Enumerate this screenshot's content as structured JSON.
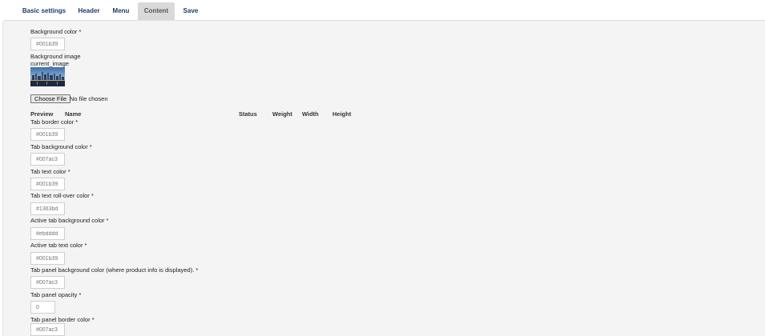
{
  "tabs": [
    {
      "label": "Basic settings",
      "active": false
    },
    {
      "label": "Header",
      "active": false
    },
    {
      "label": "Menu",
      "active": false
    },
    {
      "label": "Content",
      "active": true
    },
    {
      "label": "Save",
      "active": false
    }
  ],
  "form": {
    "background_color": {
      "label": "Background color *",
      "value": "#001b39"
    },
    "background_image": {
      "label": "Background image",
      "current_image_label": "current_image",
      "choose_file_label": "Choose File",
      "file_status": "No file chosen"
    },
    "table_headers": [
      "Preview",
      "Name",
      "Status",
      "Weight",
      "Width",
      "Height"
    ],
    "tab_border_color": {
      "label": "Tab border color *",
      "value": "#001b39"
    },
    "tab_background_color": {
      "label": "Tab background color *",
      "value": "#007ac3"
    },
    "tab_text_color": {
      "label": "Tab text color *",
      "value": "#001b39"
    },
    "tab_text_rollover_color": {
      "label": "Tab text roll-over color *",
      "value": "#1363bd"
    },
    "active_tab_background_color": {
      "label": "Active tab background color *",
      "value": "#ebdddd"
    },
    "active_tab_text_color": {
      "label": "Active tab text color *",
      "value": "#001b39"
    },
    "tab_panel_background_color": {
      "label": "Tab panel background color (where product info is displayed). *",
      "value": "#007ac3"
    },
    "tab_panel_opacity": {
      "label": "Tab panel opacity *",
      "value": "0"
    },
    "tab_panel_border_color": {
      "label": "Tab panel border color *",
      "value": "#007ac3"
    }
  },
  "colors": {
    "tab_text": "#1f3a6e",
    "active_tab_bg": "#d9d9d9",
    "panel_bg": "#f4f4f4"
  }
}
